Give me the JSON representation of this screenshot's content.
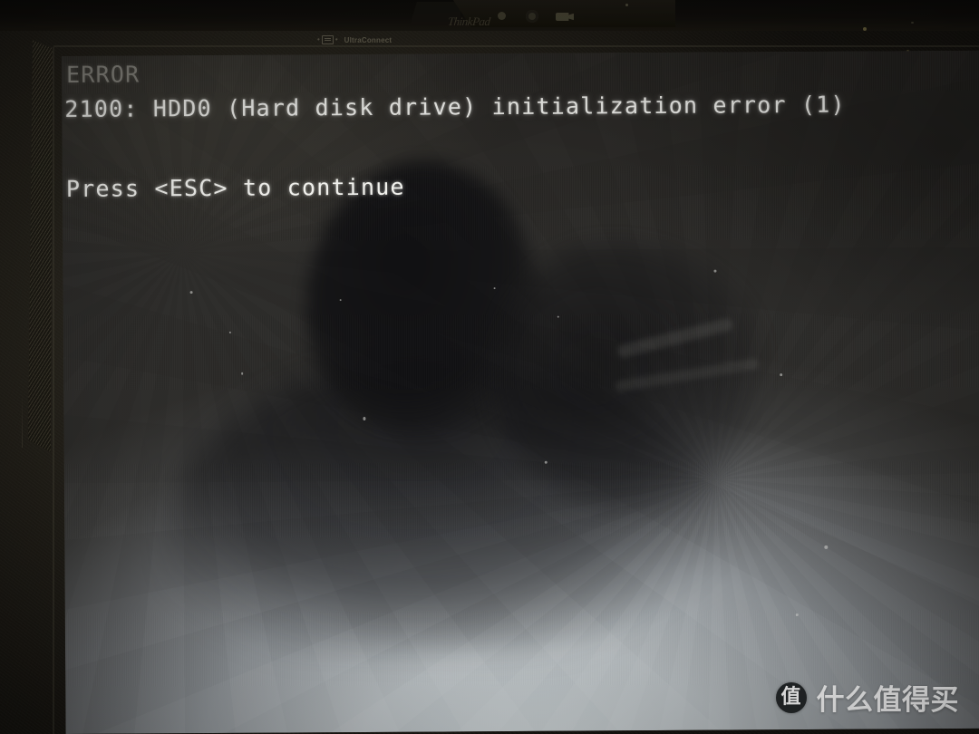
{
  "photo": {
    "subject": "laptop-screen-bios-error",
    "device": "ThinkPad laptop lid"
  },
  "bezel": {
    "ultraconnect_label": "UltraConnect",
    "ultraconnect_icon": "antenna-icon",
    "hinge_logo": "ThinkPad",
    "grille_name": "speaker-grille",
    "indicators": [
      {
        "name": "power-led",
        "icon": "power-icon"
      },
      {
        "name": "battery-led",
        "icon": "battery-icon"
      },
      {
        "name": "camera-led",
        "icon": "camera-icon"
      }
    ]
  },
  "screen": {
    "bios": {
      "heading": "ERROR",
      "detail": "2100: HDD0 (Hard disk drive) initialization error (1)",
      "prompt": "Press <ESC> to continue"
    },
    "reflection": {
      "head": "photographer-head-silhouette",
      "shoulder": "photographer-shoulder-silhouette",
      "arm": "photographer-arm-silhouette",
      "phone": "phone-reflection"
    },
    "colors": {
      "text": "#e8e8e4",
      "heading_text": "#b0aea6",
      "glare_bright": "#c6ccce",
      "glare_mid": "#8f9498",
      "panel_dark": "#2b2a28"
    }
  },
  "watermark": {
    "logo_glyph": "值",
    "text": "什么值得买",
    "logo_name": "smzdm-logo",
    "color": "#ffffff"
  }
}
